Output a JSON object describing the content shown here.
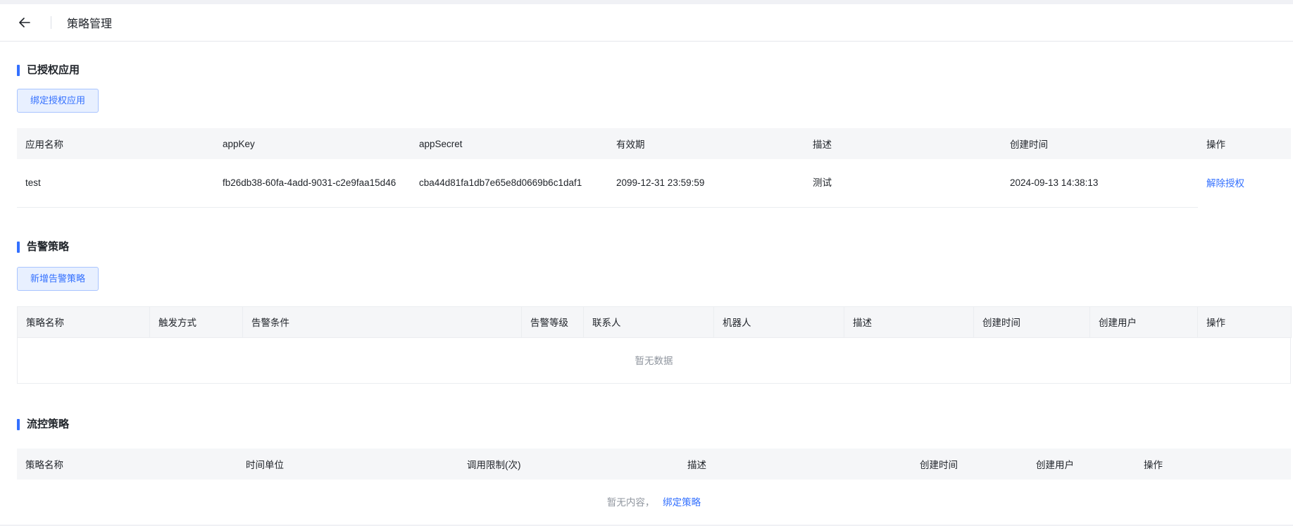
{
  "header": {
    "title": "策略管理"
  },
  "authorized": {
    "title": "已授权应用",
    "bind_button": "绑定授权应用",
    "columns": [
      "应用名称",
      "appKey",
      "appSecret",
      "有效期",
      "描述",
      "创建时间",
      "操作"
    ],
    "rows": [
      {
        "name": "test",
        "appKey": "fb26db38-60fa-4add-9031-c2e9faa15d46",
        "appSecret": "cba44d81fa1db7e65e8d0669b6c1daf1",
        "expiry": "2099-12-31 23:59:59",
        "desc": "测试",
        "created": "2024-09-13 14:38:13",
        "action": "解除授权"
      }
    ]
  },
  "alert": {
    "title": "告警策略",
    "add_button": "新增告警策略",
    "columns": [
      "策略名称",
      "触发方式",
      "告警条件",
      "告警等级",
      "联系人",
      "机器人",
      "描述",
      "创建时间",
      "创建用户",
      "操作"
    ],
    "empty_text": "暂无数据"
  },
  "flow": {
    "title": "流控策略",
    "columns": [
      "策略名称",
      "时间单位",
      "调用限制(次)",
      "描述",
      "创建时间",
      "创建用户",
      "操作"
    ],
    "empty_text": "暂无内容，",
    "empty_link": "绑定策略"
  }
}
